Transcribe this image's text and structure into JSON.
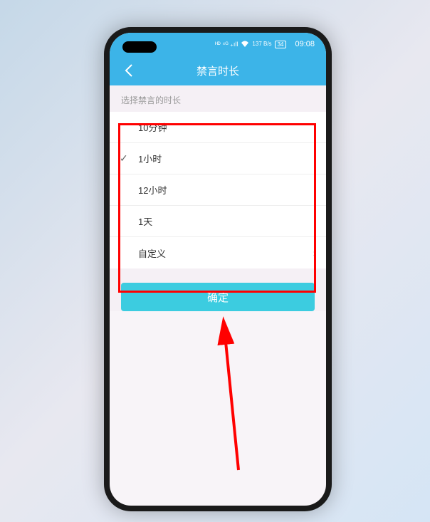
{
  "status": {
    "signal": "⁴ᴳ",
    "wifi": "📶",
    "network": "137 B/s",
    "battery": "34",
    "time": "09:08"
  },
  "header": {
    "title": "禁言时长"
  },
  "section": {
    "label": "选择禁言的时长"
  },
  "options": [
    {
      "label": "10分钟",
      "selected": false,
      "hasChevron": false
    },
    {
      "label": "1小时",
      "selected": true,
      "hasChevron": false
    },
    {
      "label": "12小时",
      "selected": false,
      "hasChevron": false
    },
    {
      "label": "1天",
      "selected": false,
      "hasChevron": false
    },
    {
      "label": "自定义",
      "selected": false,
      "hasChevron": true
    }
  ],
  "confirmButton": {
    "label": "确定"
  }
}
